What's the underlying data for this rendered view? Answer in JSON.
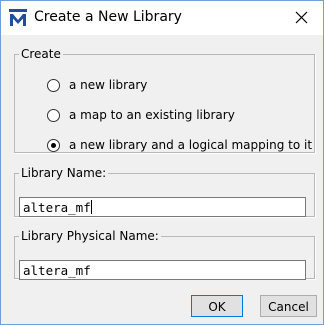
{
  "window": {
    "title": "Create a New Library",
    "app_icon": "modelsim-logo-icon",
    "close_icon": "close-icon"
  },
  "create_group": {
    "legend": "Create",
    "options": [
      {
        "label": "a new library",
        "selected": false
      },
      {
        "label": "a map to an existing library",
        "selected": false
      },
      {
        "label": "a new library and a logical mapping to it",
        "selected": true
      }
    ]
  },
  "library_name": {
    "legend": "Library Name:",
    "value": "altera_mf"
  },
  "library_physical_name": {
    "legend": "Library Physical Name:",
    "value": "altera_mf"
  },
  "buttons": {
    "ok": "OK",
    "cancel": "Cancel"
  },
  "colors": {
    "logo_blue": "#1f4f9c",
    "default_button_border": "#0078d7"
  }
}
